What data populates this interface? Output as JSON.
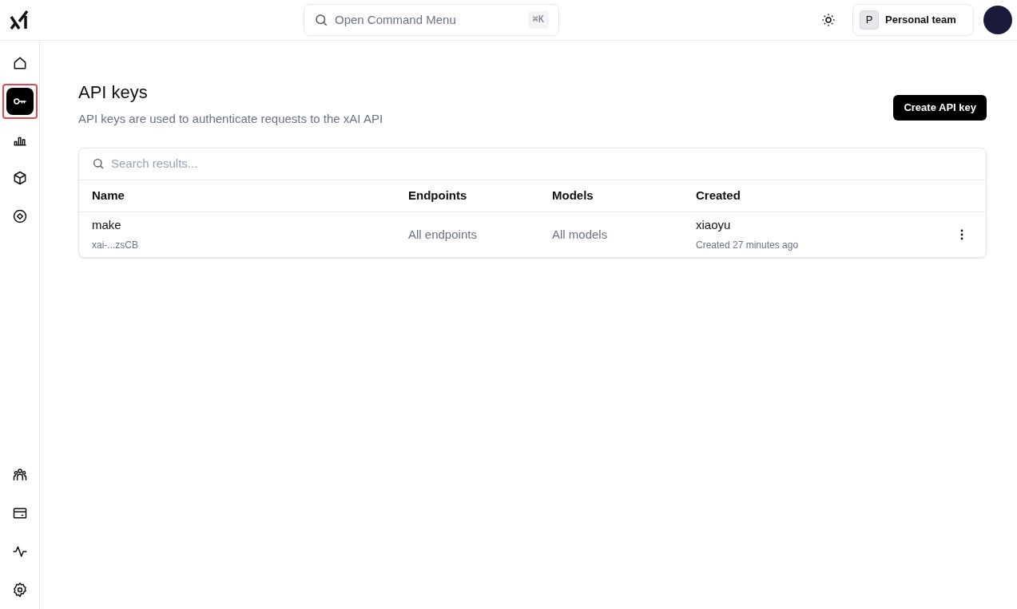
{
  "header": {
    "command_menu": {
      "placeholder": "Open Command Menu",
      "shortcut": "⌘K"
    },
    "team": {
      "initial": "P",
      "name": "Personal team"
    }
  },
  "sidebar": {
    "top_items": [
      {
        "kind": "home",
        "selected": false,
        "highlighted": false
      },
      {
        "kind": "key",
        "selected": true,
        "highlighted": true
      },
      {
        "kind": "chart",
        "selected": false,
        "highlighted": false
      },
      {
        "kind": "cube",
        "selected": false,
        "highlighted": false
      },
      {
        "kind": "target",
        "selected": false,
        "highlighted": false
      }
    ],
    "bottom_items": [
      {
        "kind": "people",
        "selected": false,
        "highlighted": false
      },
      {
        "kind": "card",
        "selected": false,
        "highlighted": false
      },
      {
        "kind": "activity",
        "selected": false,
        "highlighted": false
      },
      {
        "kind": "settings",
        "selected": false,
        "highlighted": false
      }
    ]
  },
  "page": {
    "title": "API keys",
    "subtitle": "API keys are used to authenticate requests to the xAI API",
    "create_button": "Create API key"
  },
  "table": {
    "search_placeholder": "Search results...",
    "columns": [
      "Name",
      "Endpoints",
      "Models",
      "Created"
    ],
    "rows": [
      {
        "name": "make",
        "key": "xai-...zsCB",
        "endpoints": "All endpoints",
        "models": "All models",
        "created_by": "xiaoyu",
        "created_at": "Created 27 minutes ago"
      }
    ]
  }
}
